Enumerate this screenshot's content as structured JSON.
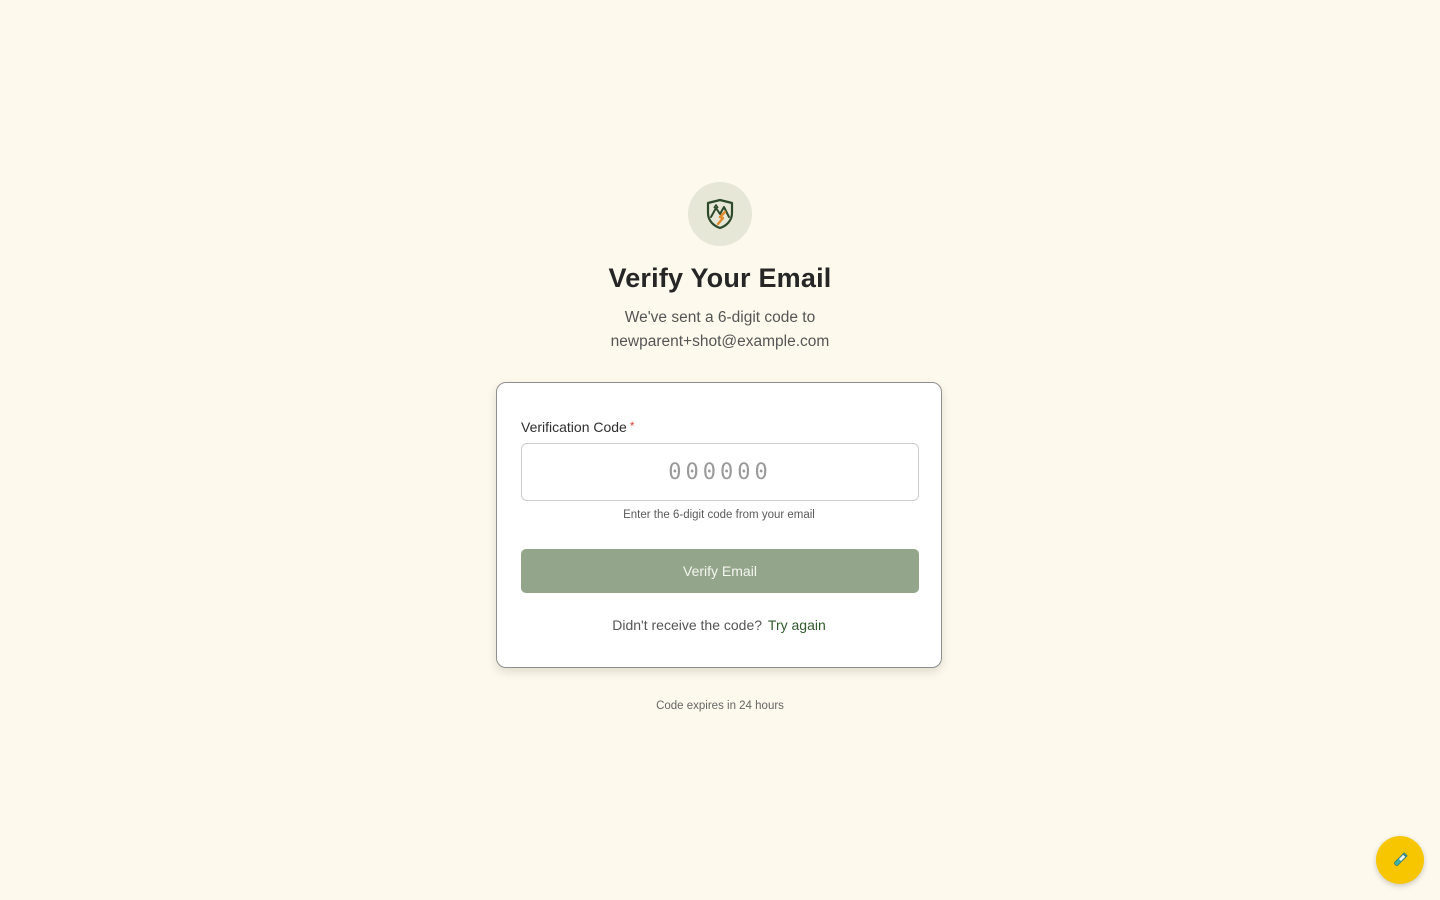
{
  "header": {
    "logo_icon": "mountain-shield-icon",
    "title": "Verify Your Email",
    "subtitle_line1": "We've sent a 6-digit code to",
    "subtitle_line2": "newparent+shot@example.com"
  },
  "form": {
    "code_label": "Verification Code",
    "required_marker": "*",
    "code_placeholder": "000000",
    "code_value": "",
    "hint": "Enter the 6-digit code from your email",
    "submit_label": "Verify Email",
    "resend_prompt": "Didn't receive the code?",
    "resend_link": "Try again"
  },
  "footer": {
    "expires_text": "Code expires in 24 hours"
  },
  "fab": {
    "icon": "test-tube-icon"
  },
  "colors": {
    "background": "#fdf9ec",
    "button": "#93a58a",
    "link": "#2f5a2c",
    "fab": "#f7c600"
  }
}
